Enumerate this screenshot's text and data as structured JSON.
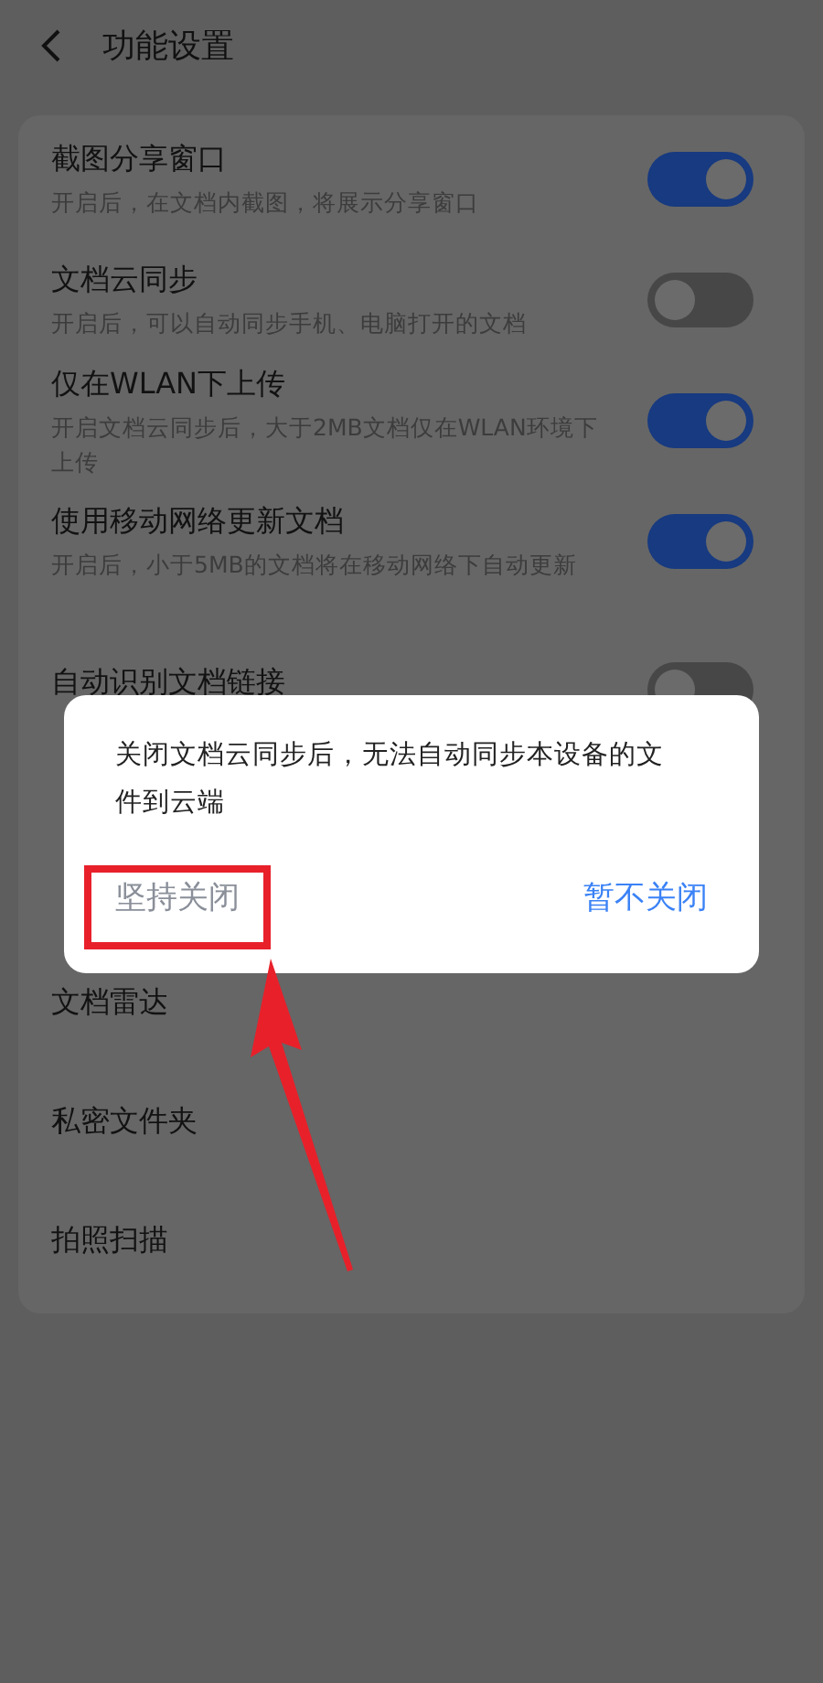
{
  "header": {
    "title": "功能设置"
  },
  "settings": [
    {
      "kind": "toggle",
      "title": "截图分享窗口",
      "subtitle": "开启后，在文档内截图，将展示分享窗口",
      "on": true
    },
    {
      "kind": "toggle",
      "title": "文档云同步",
      "subtitle": "开启后，可以自动同步手机、电脑打开的文档",
      "on": false
    },
    {
      "kind": "toggle",
      "title": "仅在WLAN下上传",
      "subtitle": "开启文档云同步后，大于2MB文档仅在WLAN环境下上传",
      "on": true
    },
    {
      "kind": "toggle",
      "title": "使用移动网络更新文档",
      "subtitle": "开启后，小于5MB的文档将在移动网络下自动更新",
      "on": true
    },
    {
      "kind": "toggle",
      "title": "自动识别文档链接",
      "on": false
    },
    {
      "kind": "link",
      "title": "文档雷达"
    },
    {
      "kind": "link",
      "title": "私密文件夹"
    },
    {
      "kind": "link",
      "title": "拍照扫描"
    }
  ],
  "dialog": {
    "message": "关闭文档云同步后，无法自动同步本设备的文件到云端",
    "buttons": [
      {
        "label": "坚持关闭",
        "kind": "confirm"
      },
      {
        "label": "暂不关闭",
        "kind": "cancel"
      }
    ]
  }
}
